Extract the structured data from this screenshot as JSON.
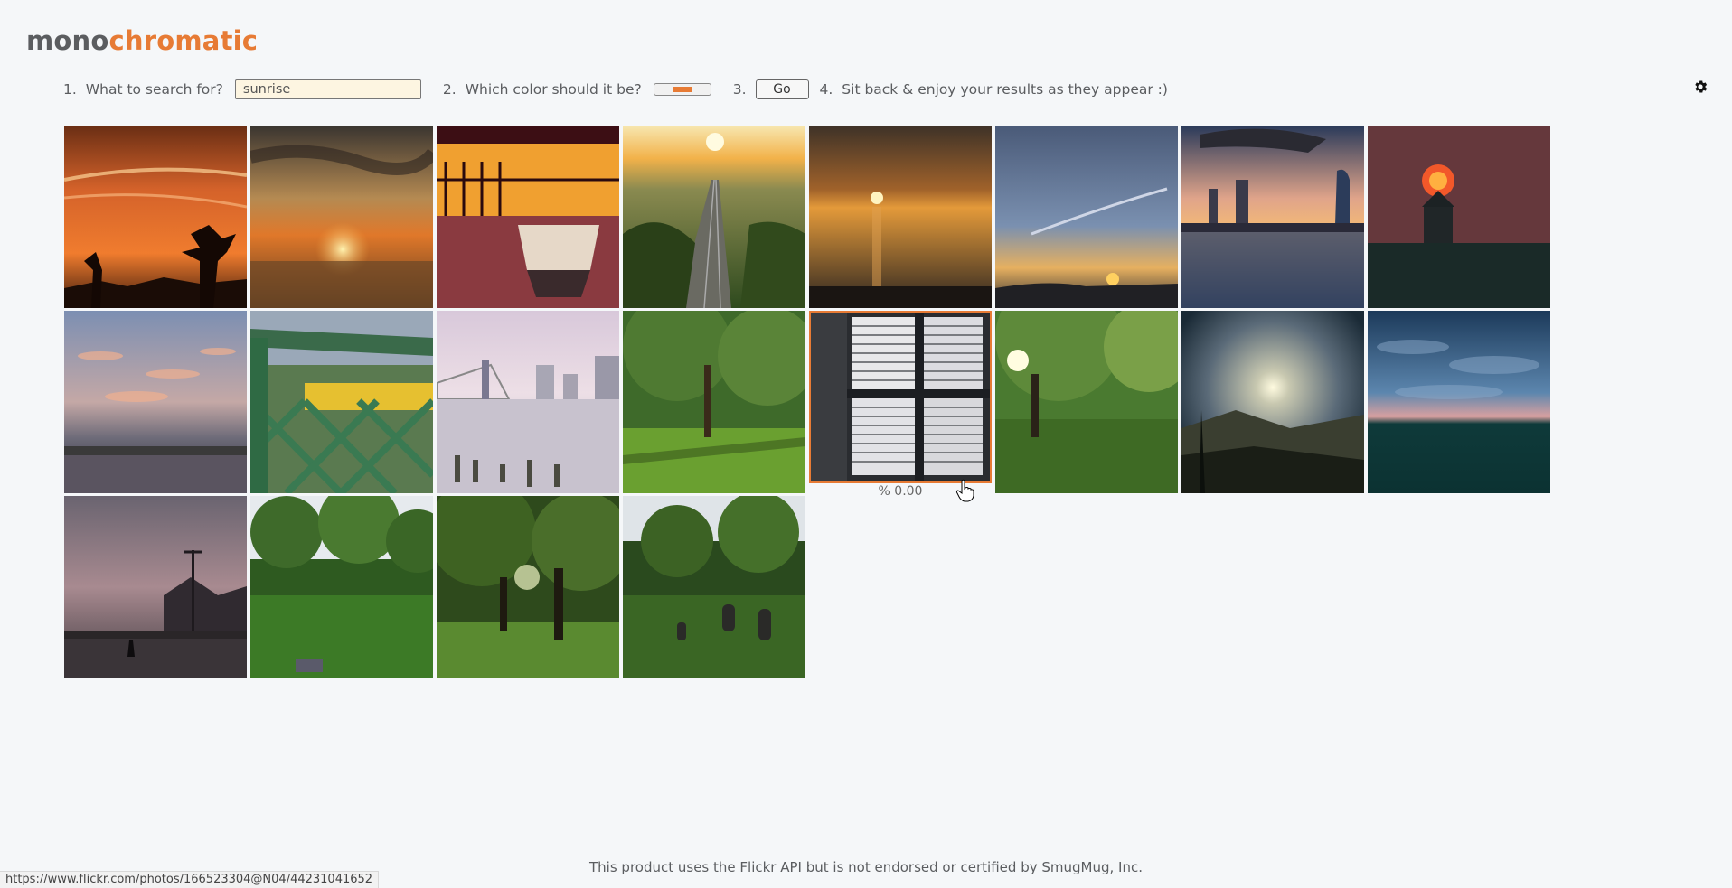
{
  "logo": {
    "part1": "mono",
    "part2": "chromatic"
  },
  "steps": {
    "s1_num": "1.",
    "s1_text": "What to search for?",
    "search_value": "sunrise",
    "s2_num": "2.",
    "s2_text": "Which color should it be?",
    "selected_color": "#e77b35",
    "s3_num": "3.",
    "go_label": "Go",
    "s4_num": "4.",
    "s4_text": "Sit back & enjoy your results as they appear :)"
  },
  "settings_icon": "gear-icon",
  "results": [
    {
      "name": "orange-sky-trees"
    },
    {
      "name": "sunset-over-sea"
    },
    {
      "name": "boat-on-porch"
    },
    {
      "name": "railway-sunrise"
    },
    {
      "name": "sea-sunset-clouds"
    },
    {
      "name": "blue-sky-sunrise"
    },
    {
      "name": "city-river-sunset"
    },
    {
      "name": "sun-over-roof"
    },
    {
      "name": "pastel-clouds-lake"
    },
    {
      "name": "green-bridge-railway"
    },
    {
      "name": "bridge-skyline-pink"
    },
    {
      "name": "green-park-trees"
    },
    {
      "name": "window-blinds"
    },
    {
      "name": "sun-through-trees"
    },
    {
      "name": "mountain-sun-haze"
    },
    {
      "name": "blue-clouds-teal"
    },
    {
      "name": "pier-person-dusk"
    },
    {
      "name": "green-meadow-trees"
    },
    {
      "name": "forest-sunlight"
    },
    {
      "name": "graveyard-trees"
    }
  ],
  "hover_percent": "% 0.00",
  "footer_text": "This product uses the Flickr API but is not endorsed or certified by SmugMug, Inc.",
  "status_url": "https://www.flickr.com/photos/166523304@N04/44231041652"
}
